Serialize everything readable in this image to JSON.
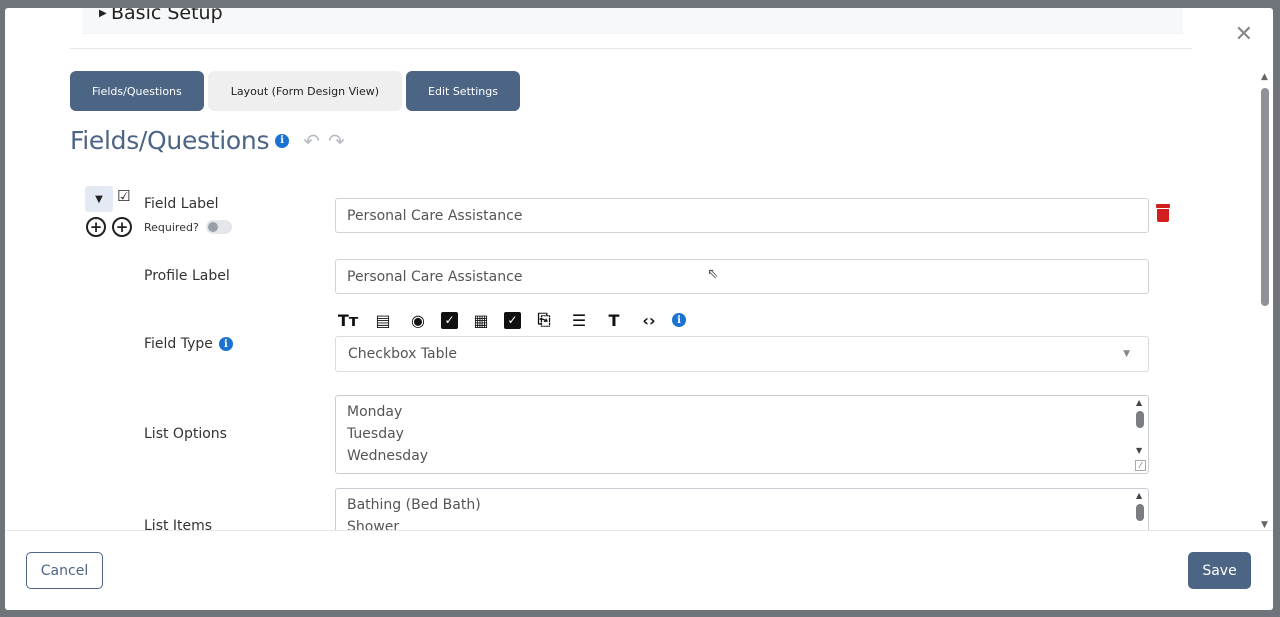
{
  "section": {
    "title": "Basic Setup"
  },
  "tabs": [
    {
      "label": "Fields/Questions",
      "style": "dark"
    },
    {
      "label": "Layout (Form Design View)",
      "style": "light"
    },
    {
      "label": "Edit Settings",
      "style": "dark"
    }
  ],
  "page": {
    "heading": "Fields/Questions",
    "info_glyph": "i"
  },
  "field": {
    "field_label_label": "Field Label",
    "field_label_value": "Personal Care Assistance",
    "required_label": "Required?",
    "required_on": false,
    "profile_label_label": "Profile Label",
    "profile_label_value": "Personal Care Assistance",
    "field_type_label": "Field Type",
    "field_type_value": "Checkbox Table",
    "list_options_label": "List Options",
    "list_options": [
      "Monday",
      "Tuesday",
      "Wednesday"
    ],
    "list_items_label": "List Items",
    "list_items": [
      "Bathing (Bed Bath)",
      "Shower"
    ]
  },
  "toolbar_icons": [
    "text-size-icon",
    "document-icon",
    "radio-icon",
    "checkbox-icon",
    "calendar-icon",
    "checkbox-multi-icon",
    "paperclip-icon",
    "checklist-icon",
    "text-icon",
    "code-icon",
    "info-icon"
  ],
  "footer": {
    "cancel_label": "Cancel",
    "save_label": "Save"
  },
  "colors": {
    "primary": "#4c6584",
    "info": "#1a73d2",
    "danger": "#d31e1e"
  }
}
